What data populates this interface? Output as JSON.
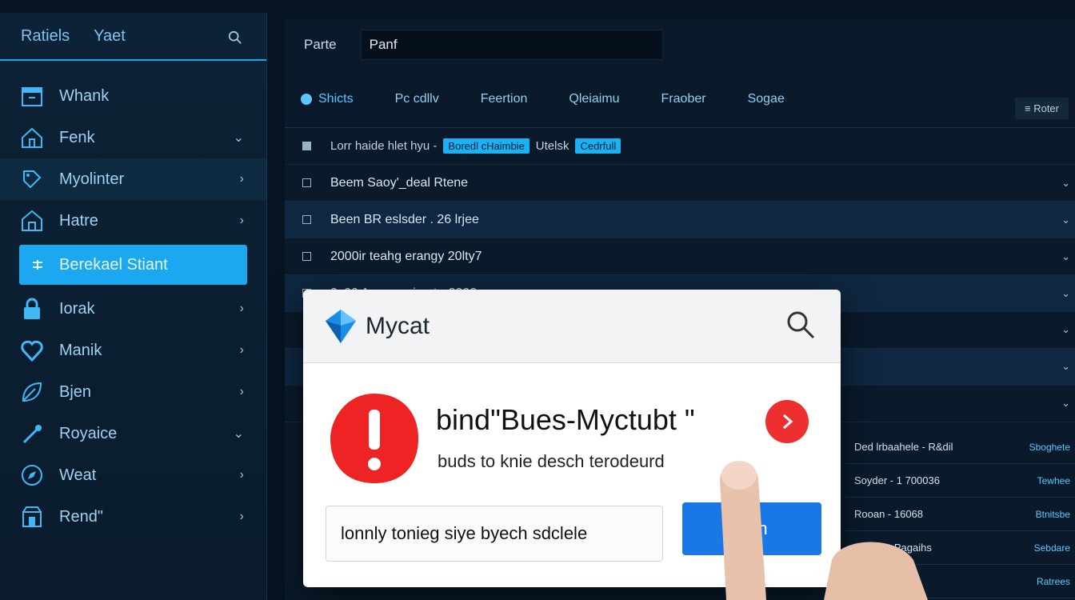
{
  "sidebar": {
    "tabs": [
      "Ratiels",
      "Yaet"
    ],
    "items": [
      {
        "label": "Whank",
        "icon": "storefront-icon",
        "arrow": ""
      },
      {
        "label": "Fenk",
        "icon": "home-icon",
        "arrow": "⌄"
      },
      {
        "label": "Myolinter",
        "icon": "tag-icon",
        "arrow": "›"
      },
      {
        "label": "Hatre",
        "icon": "house-icon",
        "arrow": "›"
      },
      {
        "label": "Berekael Stiant",
        "icon": "list-icon",
        "arrow": ""
      },
      {
        "label": "Iorak",
        "icon": "lock-icon",
        "arrow": "›"
      },
      {
        "label": "Manik",
        "icon": "heart-icon",
        "arrow": "›"
      },
      {
        "label": "Bjen",
        "icon": "leaf-icon",
        "arrow": "›"
      },
      {
        "label": "Royaice",
        "icon": "pen-icon",
        "arrow": "⌄"
      },
      {
        "label": "Weat",
        "icon": "compass-icon",
        "arrow": "›"
      },
      {
        "label": "Rend\"",
        "icon": "box-icon",
        "arrow": "›"
      }
    ]
  },
  "main": {
    "top_label": "Parte",
    "top_field": "Panf",
    "tabs": [
      "Shicts",
      "Pc cdllv",
      "Feertion",
      "Qleiaimu",
      "Fraober",
      "Sogae"
    ],
    "filter_label": "Roter",
    "list_header": {
      "text": "Lorr haide hlet hyu -",
      "tag1": "Boredl cHaimbie",
      "text2": "Utelsk",
      "tag2": "Cedrfull"
    },
    "rows": [
      "Beem Saoy'_deal Rtene",
      "Been BR eslsder . 26 lrjee",
      "2000ir teahg erangy 20lty7",
      "0c66 Areeena iumt - 0090"
    ],
    "side_list": [
      {
        "name": "Ded lrbaahele - R&dil",
        "link": "Sboghete"
      },
      {
        "name": "Soyder - 1 700036",
        "link": "Tewhee"
      },
      {
        "name": "Rooan - 16068",
        "link": "Btnitsbe"
      },
      {
        "name": "Rhode - Pagaihs",
        "link": "Sebdare"
      },
      {
        "name": "",
        "link": "Ratrees"
      }
    ]
  },
  "dialog": {
    "title": "Mycat",
    "message": "bind\"Bues-Myctubt \"",
    "subtext": "buds to knie desch terodeurd",
    "input_value": "lonnly tonieg siye byech sdclele",
    "button_label": "W      h"
  },
  "colors": {
    "accent": "#1ba8f0",
    "alert": "#ee2f2f",
    "button": "#1a78e6"
  }
}
